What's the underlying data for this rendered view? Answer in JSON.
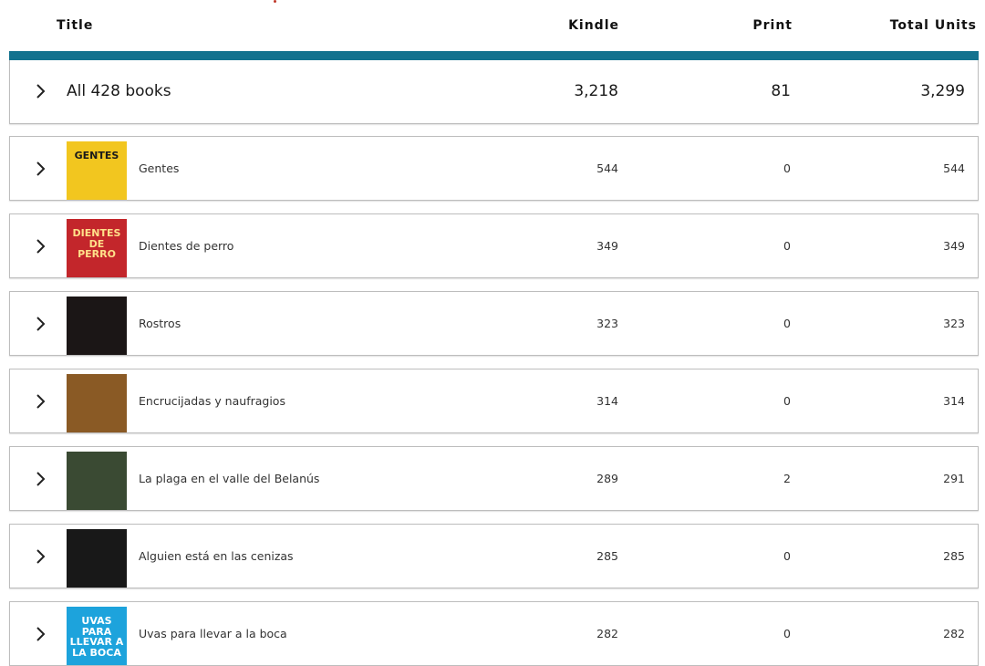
{
  "header": {
    "title_col": "Title",
    "kindle_col": "Kindle",
    "print_col": "Print",
    "total_col": "Total Units"
  },
  "summary": {
    "label": "All 428 books",
    "kindle": "3,218",
    "print": "81",
    "total": "3,299"
  },
  "books": [
    {
      "title": "Gentes",
      "kindle": "544",
      "print": "0",
      "total": "544",
      "cover_text": "GENTES",
      "cover_color": "#f2c61f",
      "cover_text_color": "#1a1a1a"
    },
    {
      "title": "Dientes de perro",
      "kindle": "349",
      "print": "0",
      "total": "349",
      "cover_text": "DIENTES DE PERRO",
      "cover_color": "#c3262b",
      "cover_text_color": "#ffe08a"
    },
    {
      "title": "Rostros",
      "kindle": "323",
      "print": "0",
      "total": "323",
      "cover_text": "",
      "cover_color": "#1b1616",
      "cover_text_color": "#e6e6e6"
    },
    {
      "title": "Encrucijadas y naufragios",
      "kindle": "314",
      "print": "0",
      "total": "314",
      "cover_text": "",
      "cover_color": "#8a5a25",
      "cover_text_color": "#f4e3b0"
    },
    {
      "title": "La plaga en el valle del Belanús",
      "kindle": "289",
      "print": "2",
      "total": "291",
      "cover_text": "",
      "cover_color": "#3a4a33",
      "cover_text_color": "#e0c77a"
    },
    {
      "title": "Alguien está en las cenizas",
      "kindle": "285",
      "print": "0",
      "total": "285",
      "cover_text": "",
      "cover_color": "#181818",
      "cover_text_color": "#e8cbb5"
    },
    {
      "title": "Uvas para llevar a la boca",
      "kindle": "282",
      "print": "0",
      "total": "282",
      "cover_text": "UVAS PARA LLEVAR A LA BOCA",
      "cover_color": "#1da3dc",
      "cover_text_color": "#ffffff"
    }
  ]
}
